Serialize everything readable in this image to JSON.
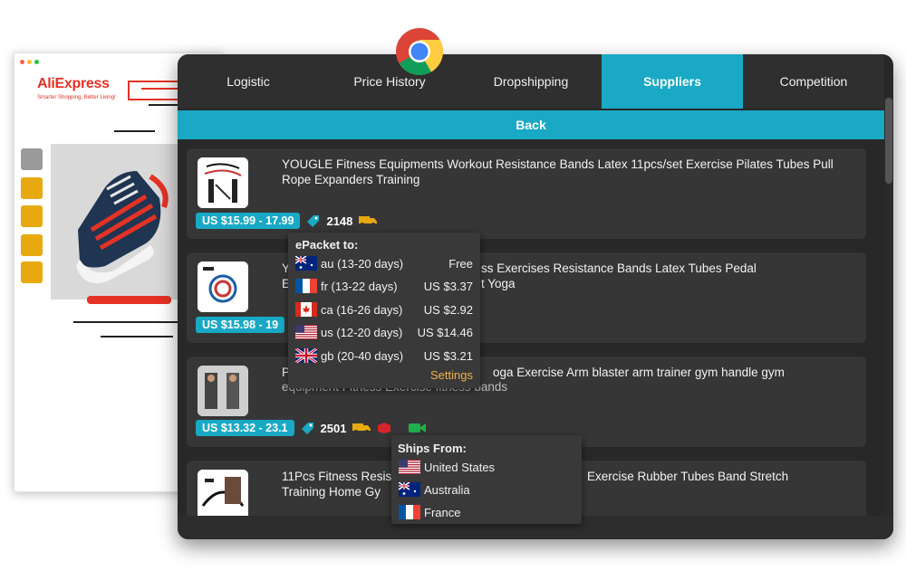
{
  "aliexpress": {
    "logo": "AliExpress",
    "tagline": "Smarter Shopping, Better Living!"
  },
  "tabs": [
    {
      "label": "Logistic",
      "active": false
    },
    {
      "label": "Price History",
      "active": false
    },
    {
      "label": "Dropshipping",
      "active": false
    },
    {
      "label": "Suppliers",
      "active": true
    },
    {
      "label": "Competition",
      "active": false
    }
  ],
  "back_label": "Back",
  "products": [
    {
      "title": "YOUGLE Fitness Equipments Workout Resistance Bands Latex 11pcs/set Exercise Pilates Tubes Pull Rope Expanders Training",
      "price": "US $15.99 - 17.99",
      "orders": "2148"
    },
    {
      "title_left": "Y",
      "title_right": "ss Exercises Resistance Bands Latex Tubes Pedal",
      "title_left2": "E",
      "title_right2": "t Yoga",
      "price": "US $15.98 - 19"
    },
    {
      "title_left": "P",
      "title_right": "oga Exercise Arm blaster arm trainer gym handle gym",
      "title_line2": "equipment Fitness Exercise fitness bands",
      "price": "US $13.32 - 23.1",
      "orders": "2501"
    },
    {
      "title_left": "11Pcs Fitness Resis",
      "title_right": "Exercise Rubber Tubes Band Stretch",
      "title_left2": "Training Home Gy"
    }
  ],
  "epacket_popup": {
    "title": "ePacket to:",
    "rows": [
      {
        "flag": "au",
        "country": "au (13-20 days)",
        "cost": "Free"
      },
      {
        "flag": "fr",
        "country": "fr (13-22 days)",
        "cost": "US $3.37"
      },
      {
        "flag": "ca",
        "country": "ca (16-26 days)",
        "cost": "US $2.92"
      },
      {
        "flag": "us",
        "country": "us (12-20 days)",
        "cost": "US $14.46"
      },
      {
        "flag": "gb",
        "country": "gb (20-40 days)",
        "cost": "US $3.21"
      }
    ],
    "settings": "Settings"
  },
  "ships_popup": {
    "title": "Ships From:",
    "rows": [
      {
        "flag": "us",
        "country": "United States"
      },
      {
        "flag": "au",
        "country": "Australia"
      },
      {
        "flag": "fr",
        "country": "France"
      }
    ]
  },
  "colors": {
    "accent": "#19a9c5",
    "panel": "#282828",
    "card": "#363636",
    "brand_red": "#e43225",
    "settings": "#f0b14a"
  }
}
